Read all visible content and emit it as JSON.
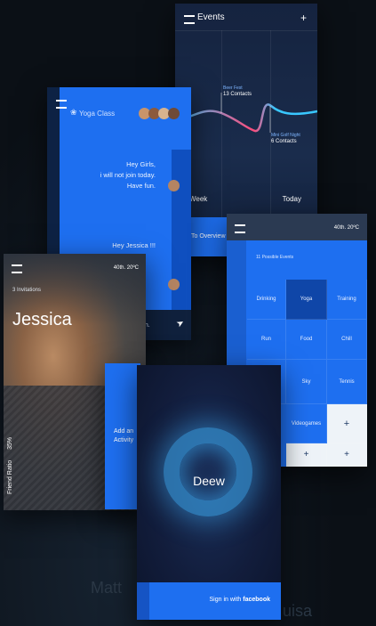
{
  "events": {
    "title": "Events",
    "add_icon": "plus-icon",
    "annotations": [
      {
        "label": "Beer Fest",
        "count": "13 Contacts"
      },
      {
        "label": "Mini Golf Night",
        "count": "6 Contacts"
      }
    ],
    "bottom": {
      "left": "Week",
      "right": "Today"
    },
    "overview": "To Overview"
  },
  "yoga_chat": {
    "title": "Yoga Class",
    "message1": [
      "Hey Girls,",
      "i will not join today.",
      "Have fun."
    ],
    "message2": "Hey Jessica !!!",
    "reply_partial": "er then."
  },
  "profile": {
    "time": "40th. 20ºC",
    "invites": "3 Invitations",
    "name": "Jessica",
    "side_label": "Friend Ratio",
    "ratio": "35%",
    "add_activity": [
      "Add an",
      "Activity"
    ]
  },
  "activities": {
    "time": "40th. 20ºC",
    "possible": "11 Possible Events",
    "tiles": [
      "Drinking",
      "Yoga",
      "Training",
      "Run",
      "Food",
      "Chill",
      "",
      "Sky",
      "Tennis",
      "Videogames"
    ],
    "plus": "+"
  },
  "login": {
    "app_name": "Deew",
    "signin_prefix": "Sign in with",
    "signin_brand": "facebook"
  },
  "background_ghost": {
    "left": "Matt",
    "right": "uisa"
  },
  "colors": {
    "accent": "#1e6ff0",
    "deep": "#0f2a52",
    "chart_line": "#39c7ff",
    "chart_pink": "#ff4b7a"
  }
}
